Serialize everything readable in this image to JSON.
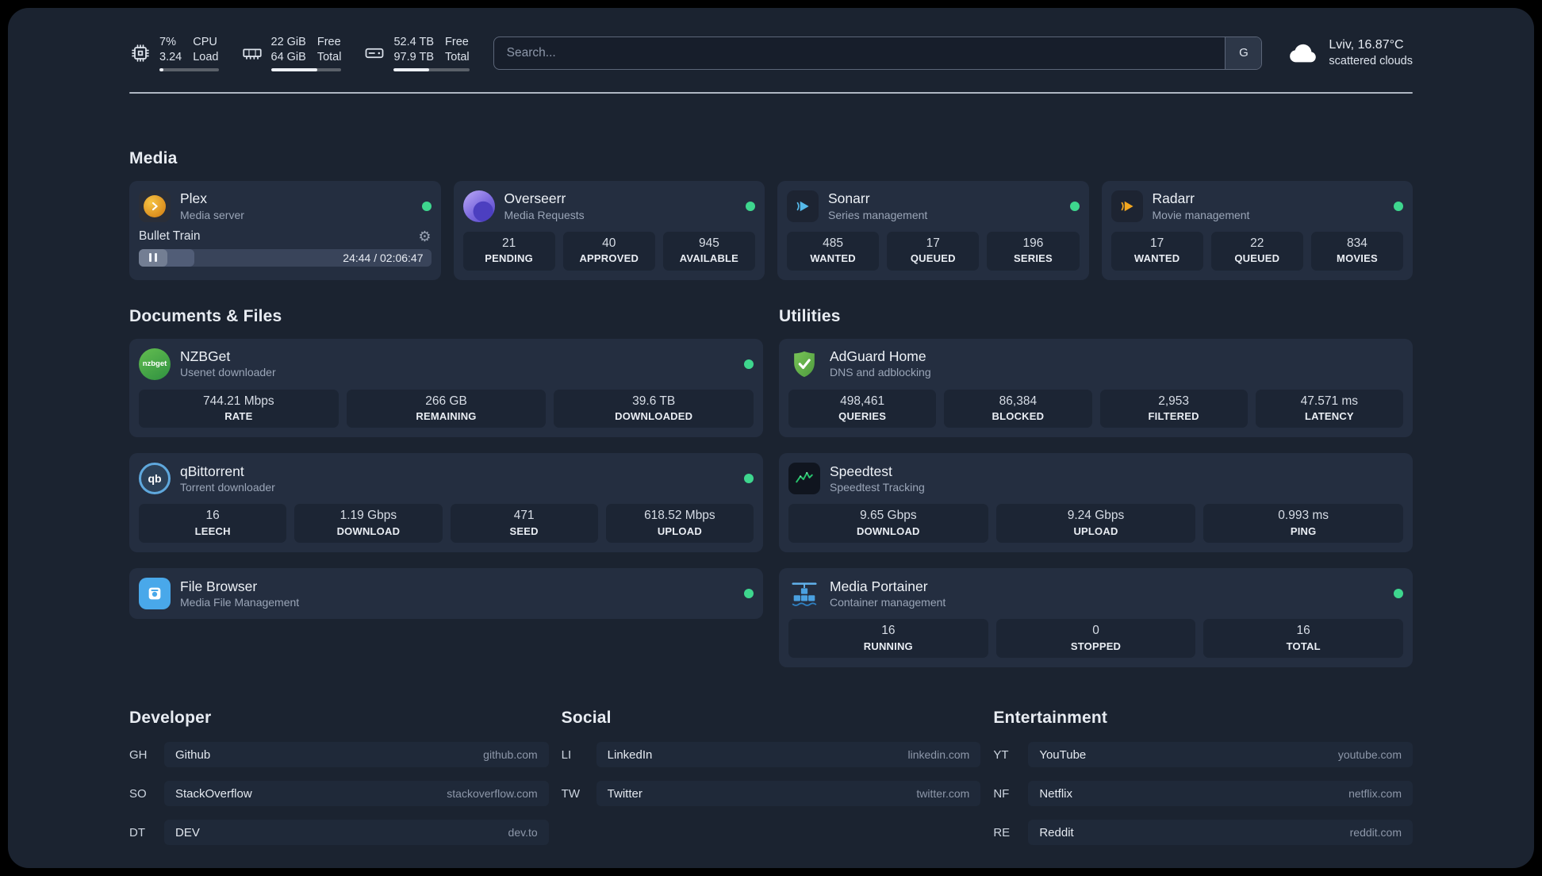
{
  "colors": {
    "status_green": "#3ed68e",
    "page_bg": "#1b2330",
    "card_bg": "#242e40"
  },
  "icons": {
    "gear": "⚙",
    "nzbget_logo_text": "nzbget",
    "qbittorrent_logo_text": "qb"
  },
  "topbar": {
    "cpu": {
      "value1": "7%",
      "value2": "3.24",
      "label1": "CPU",
      "label2": "Load",
      "percent": 7
    },
    "memory": {
      "value1": "22 GiB",
      "value2": "64 GiB",
      "label1": "Free",
      "label2": "Total",
      "percent": 66
    },
    "disk": {
      "value1": "52.4 TB",
      "value2": "97.9 TB",
      "label1": "Free",
      "label2": "Total",
      "percent": 47
    },
    "search": {
      "placeholder": "Search...",
      "engine_label": "G"
    },
    "weather": {
      "location": "Lviv, 16.87°C",
      "condition": "scattered clouds"
    }
  },
  "media": {
    "title": "Media",
    "plex": {
      "name": "Plex",
      "subtitle": "Media server",
      "now_playing": "Bullet Train",
      "time": "24:44 / 02:06:47",
      "progress_percent": 19
    },
    "overseerr": {
      "name": "Overseerr",
      "subtitle": "Media Requests",
      "stats": [
        {
          "value": "21",
          "label": "PENDING"
        },
        {
          "value": "40",
          "label": "APPROVED"
        },
        {
          "value": "945",
          "label": "AVAILABLE"
        }
      ]
    },
    "sonarr": {
      "name": "Sonarr",
      "subtitle": "Series management",
      "stats": [
        {
          "value": "485",
          "label": "WANTED"
        },
        {
          "value": "17",
          "label": "QUEUED"
        },
        {
          "value": "196",
          "label": "SERIES"
        }
      ]
    },
    "radarr": {
      "name": "Radarr",
      "subtitle": "Movie management",
      "stats": [
        {
          "value": "17",
          "label": "WANTED"
        },
        {
          "value": "22",
          "label": "QUEUED"
        },
        {
          "value": "834",
          "label": "MOVIES"
        }
      ]
    }
  },
  "documents": {
    "title": "Documents & Files",
    "nzbget": {
      "name": "NZBGet",
      "subtitle": "Usenet downloader",
      "stats": [
        {
          "value": "744.21 Mbps",
          "label": "RATE"
        },
        {
          "value": "266 GB",
          "label": "REMAINING"
        },
        {
          "value": "39.6 TB",
          "label": "DOWNLOADED"
        }
      ]
    },
    "qbittorrent": {
      "name": "qBittorrent",
      "subtitle": "Torrent downloader",
      "stats": [
        {
          "value": "16",
          "label": "LEECH"
        },
        {
          "value": "1.19 Gbps",
          "label": "DOWNLOAD"
        },
        {
          "value": "471",
          "label": "SEED"
        },
        {
          "value": "618.52 Mbps",
          "label": "UPLOAD"
        }
      ]
    },
    "filebrowser": {
      "name": "File Browser",
      "subtitle": "Media File Management"
    }
  },
  "utilities": {
    "title": "Utilities",
    "adguard": {
      "name": "AdGuard Home",
      "subtitle": "DNS and adblocking",
      "stats": [
        {
          "value": "498,461",
          "label": "QUERIES"
        },
        {
          "value": "86,384",
          "label": "BLOCKED"
        },
        {
          "value": "2,953",
          "label": "FILTERED"
        },
        {
          "value": "47.571 ms",
          "label": "LATENCY"
        }
      ]
    },
    "speedtest": {
      "name": "Speedtest",
      "subtitle": "Speedtest Tracking",
      "stats": [
        {
          "value": "9.65 Gbps",
          "label": "DOWNLOAD"
        },
        {
          "value": "9.24 Gbps",
          "label": "UPLOAD"
        },
        {
          "value": "0.993 ms",
          "label": "PING"
        }
      ]
    },
    "portainer": {
      "name": "Media Portainer",
      "subtitle": "Container management",
      "stats": [
        {
          "value": "16",
          "label": "RUNNING"
        },
        {
          "value": "0",
          "label": "STOPPED"
        },
        {
          "value": "16",
          "label": "TOTAL"
        }
      ]
    }
  },
  "bookmarks": {
    "developer": {
      "title": "Developer",
      "links": [
        {
          "abbr": "GH",
          "name": "Github",
          "domain": "github.com"
        },
        {
          "abbr": "SO",
          "name": "StackOverflow",
          "domain": "stackoverflow.com"
        },
        {
          "abbr": "DT",
          "name": "DEV",
          "domain": "dev.to"
        }
      ]
    },
    "social": {
      "title": "Social",
      "links": [
        {
          "abbr": "LI",
          "name": "LinkedIn",
          "domain": "linkedin.com"
        },
        {
          "abbr": "TW",
          "name": "Twitter",
          "domain": "twitter.com"
        }
      ]
    },
    "entertainment": {
      "title": "Entertainment",
      "links": [
        {
          "abbr": "YT",
          "name": "YouTube",
          "domain": "youtube.com"
        },
        {
          "abbr": "NF",
          "name": "Netflix",
          "domain": "netflix.com"
        },
        {
          "abbr": "RE",
          "name": "Reddit",
          "domain": "reddit.com"
        }
      ]
    }
  }
}
